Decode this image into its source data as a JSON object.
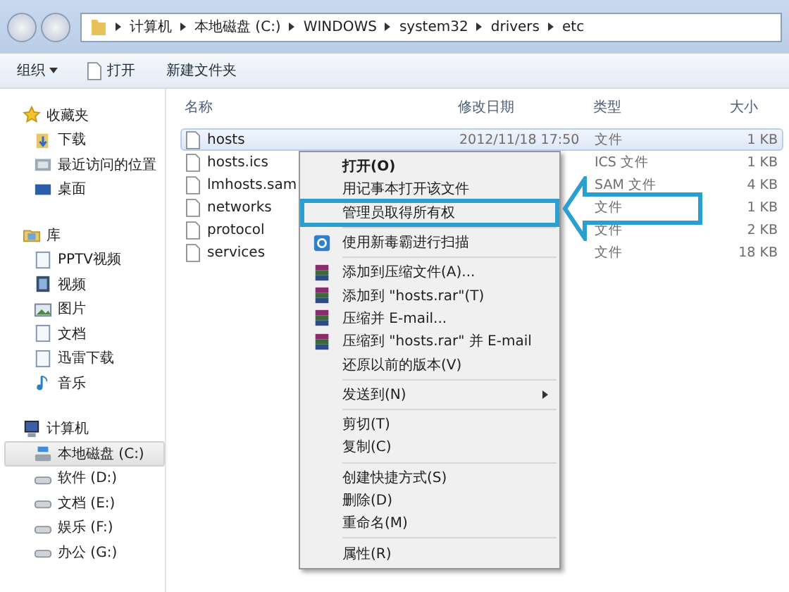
{
  "address_bar": {
    "crumbs": [
      "计算机",
      "本地磁盘 (C:)",
      "WINDOWS",
      "system32",
      "drivers",
      "etc"
    ]
  },
  "toolbar": {
    "organize": "组织",
    "open": "打开",
    "new_folder": "新建文件夹"
  },
  "sidebar": {
    "groups": [
      {
        "label": "收藏夹",
        "items": [
          {
            "label": "下载",
            "selected": false
          },
          {
            "label": "最近访问的位置",
            "selected": false
          },
          {
            "label": "桌面",
            "selected": false
          }
        ]
      },
      {
        "label": "库",
        "items": [
          {
            "label": "PPTV视频",
            "selected": false
          },
          {
            "label": "视频",
            "selected": false
          },
          {
            "label": "图片",
            "selected": false
          },
          {
            "label": "文档",
            "selected": false
          },
          {
            "label": "迅雷下载",
            "selected": false
          },
          {
            "label": "音乐",
            "selected": false
          }
        ]
      },
      {
        "label": "计算机",
        "items": [
          {
            "label": "本地磁盘 (C:)",
            "selected": true
          },
          {
            "label": "软件 (D:)",
            "selected": false
          },
          {
            "label": "文档 (E:)",
            "selected": false
          },
          {
            "label": "娱乐 (F:)",
            "selected": false
          },
          {
            "label": "办公 (G:)",
            "selected": false
          }
        ]
      }
    ]
  },
  "table": {
    "columns": [
      "名称",
      "修改日期",
      "类型",
      "大小"
    ],
    "rows": [
      {
        "name": "hosts",
        "date": "2012/11/18 17:50",
        "type": "文件",
        "size": "1 KB",
        "selected": true
      },
      {
        "name": "hosts.ics",
        "type": "ICS 文件",
        "size": "1 KB",
        "selected": false
      },
      {
        "name": "lmhosts.sam",
        "type": "SAM 文件",
        "size": "4 KB",
        "selected": false
      },
      {
        "name": "networks",
        "type": "文件",
        "size": "1 KB",
        "selected": false
      },
      {
        "name": "protocol",
        "type": "文件",
        "size": "2 KB",
        "selected": false
      },
      {
        "name": "services",
        "type": "文件",
        "size": "18 KB",
        "selected": false
      }
    ]
  },
  "context_menu": {
    "items": [
      {
        "kind": "item",
        "label": "打开(O)",
        "highlighted": false
      },
      {
        "kind": "item",
        "label": "用记事本打开该文件",
        "highlighted": false
      },
      {
        "kind": "item",
        "label": "管理员取得所有权",
        "highlighted": true
      },
      {
        "kind": "separator"
      },
      {
        "kind": "shield",
        "label": "使用新毒霸进行扫描",
        "highlighted": false
      },
      {
        "kind": "separator"
      },
      {
        "kind": "archive",
        "label": "添加到压缩文件(A)...",
        "highlighted": false
      },
      {
        "kind": "archive",
        "label": "添加到 \"hosts.rar\"(T)",
        "highlighted": false
      },
      {
        "kind": "archive",
        "label": "压缩并 E-mail...",
        "highlighted": false
      },
      {
        "kind": "archive",
        "label": "压缩到 \"hosts.rar\" 并 E-mail",
        "highlighted": false
      },
      {
        "kind": "item",
        "label": "还原以前的版本(V)",
        "highlighted": false
      },
      {
        "kind": "separator"
      },
      {
        "kind": "submenu",
        "label": "发送到(N)",
        "highlighted": false
      },
      {
        "kind": "separator"
      },
      {
        "kind": "item",
        "label": "剪切(T)",
        "highlighted": false
      },
      {
        "kind": "item",
        "label": "复制(C)",
        "highlighted": false
      },
      {
        "kind": "separator"
      },
      {
        "kind": "item",
        "label": "创建快捷方式(S)",
        "highlighted": false
      },
      {
        "kind": "item",
        "label": "删除(D)",
        "highlighted": false
      },
      {
        "kind": "item",
        "label": "重命名(M)",
        "highlighted": false
      },
      {
        "kind": "separator"
      },
      {
        "kind": "item",
        "label": "属性(R)",
        "highlighted": false
      }
    ]
  }
}
